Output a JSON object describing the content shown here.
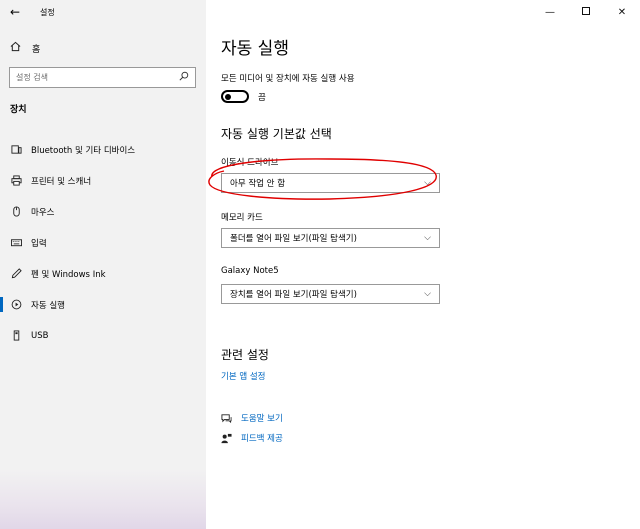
{
  "window": {
    "title": "설정"
  },
  "sidebar": {
    "home_label": "홈",
    "search_placeholder": "설정 검색",
    "section_title": "장치",
    "items": [
      {
        "label": "Bluetooth 및 기타 디바이스",
        "icon": "bluetooth-device-icon"
      },
      {
        "label": "프린터 및 스캐너",
        "icon": "printer-icon"
      },
      {
        "label": "마우스",
        "icon": "mouse-icon"
      },
      {
        "label": "입력",
        "icon": "keyboard-icon"
      },
      {
        "label": "펜 및 Windows Ink",
        "icon": "pen-icon"
      },
      {
        "label": "자동 실행",
        "icon": "autoplay-icon"
      },
      {
        "label": "USB",
        "icon": "usb-icon"
      }
    ]
  },
  "main": {
    "title": "자동 실행",
    "toggle_caption": "모든 미디어 및 장치에 자동 실행 사용",
    "toggle_state": "끔",
    "defaults_heading": "자동 실행 기본값 선택",
    "fields": [
      {
        "label": "이동식 드라이브",
        "value": "아무 작업 안 함"
      },
      {
        "label": "메모리 카드",
        "value": "폴더를 열어 파일 보기(파일 탐색기)"
      },
      {
        "label": "Galaxy Note5",
        "value": "장치를 열어 파일 보기(파일 탐색기)"
      }
    ],
    "related_heading": "관련 설정",
    "related_link": "기본 앱 설정",
    "help_label": "도움말 보기",
    "feedback_label": "피드백 제공"
  },
  "colors": {
    "accent": "#0067c0",
    "annotation": "#e00000",
    "sidebar_bg": "#f2f2f2"
  }
}
